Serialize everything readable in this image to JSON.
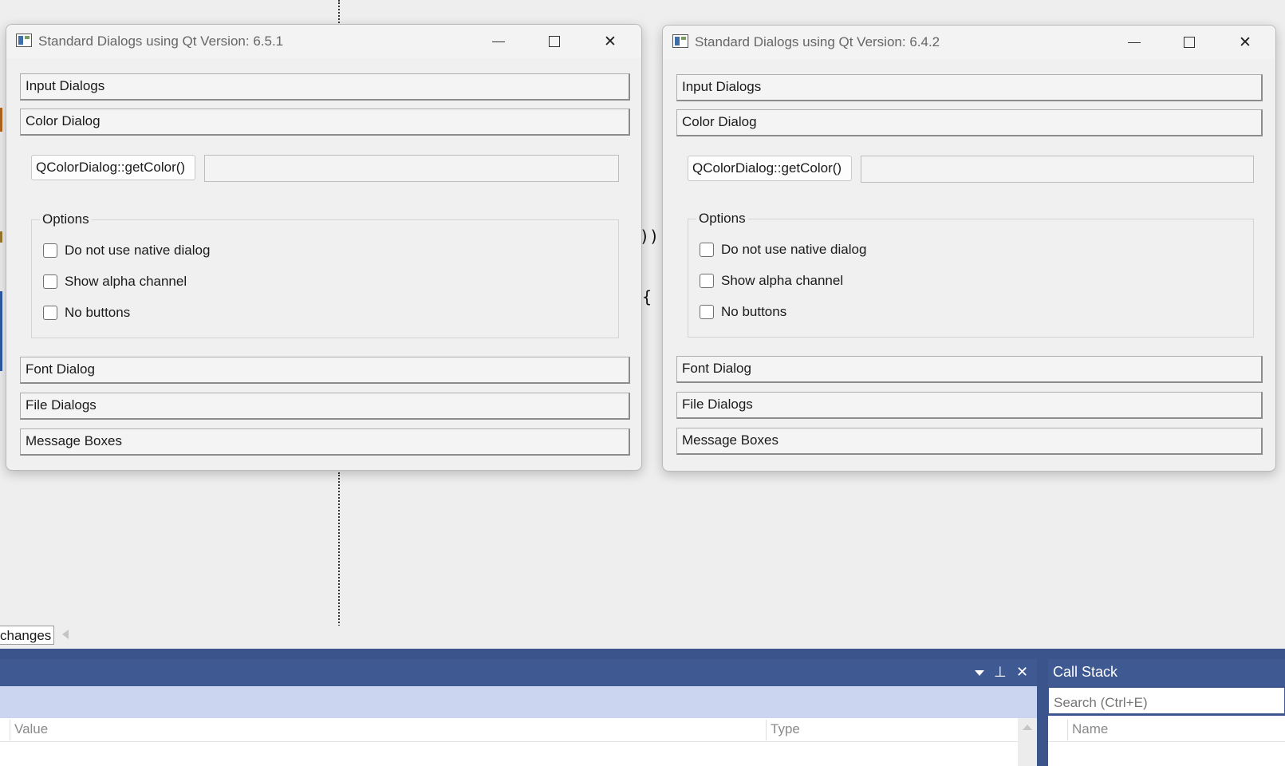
{
  "windows": [
    {
      "title": "Standard Dialogs using Qt Version: 6.5.1",
      "sections": {
        "input": "Input Dialogs",
        "color": "Color Dialog",
        "font": "Font Dialog",
        "file": "File Dialogs",
        "message": "Message Boxes"
      },
      "color_button": "QColorDialog::getColor()",
      "options_title": "Options",
      "options": [
        "Do not use native dialog",
        "Show alpha channel",
        "No buttons"
      ]
    },
    {
      "title": "Standard Dialogs using Qt Version: 6.4.2",
      "sections": {
        "input": "Input Dialogs",
        "color": "Color Dialog",
        "font": "Font Dialog",
        "file": "File Dialogs",
        "message": "Message Boxes"
      },
      "color_button": "QColorDialog::getColor()",
      "options_title": "Options",
      "options": [
        "Do not use native dialog",
        "Show alpha channel",
        "No buttons"
      ]
    }
  ],
  "editor": {
    "code_paren": "))",
    "code_brace": "{",
    "tab_label": "changes"
  },
  "watch_panel": {
    "columns": [
      "Value",
      "Type"
    ]
  },
  "call_stack": {
    "title": "Call Stack",
    "search_placeholder": "Search (Ctrl+E)",
    "columns": [
      "Name"
    ]
  },
  "colors": {
    "vs_frame": "#3b548c",
    "panel_band": "#cbd5ef",
    "window_bg": "#f0f0f0"
  }
}
